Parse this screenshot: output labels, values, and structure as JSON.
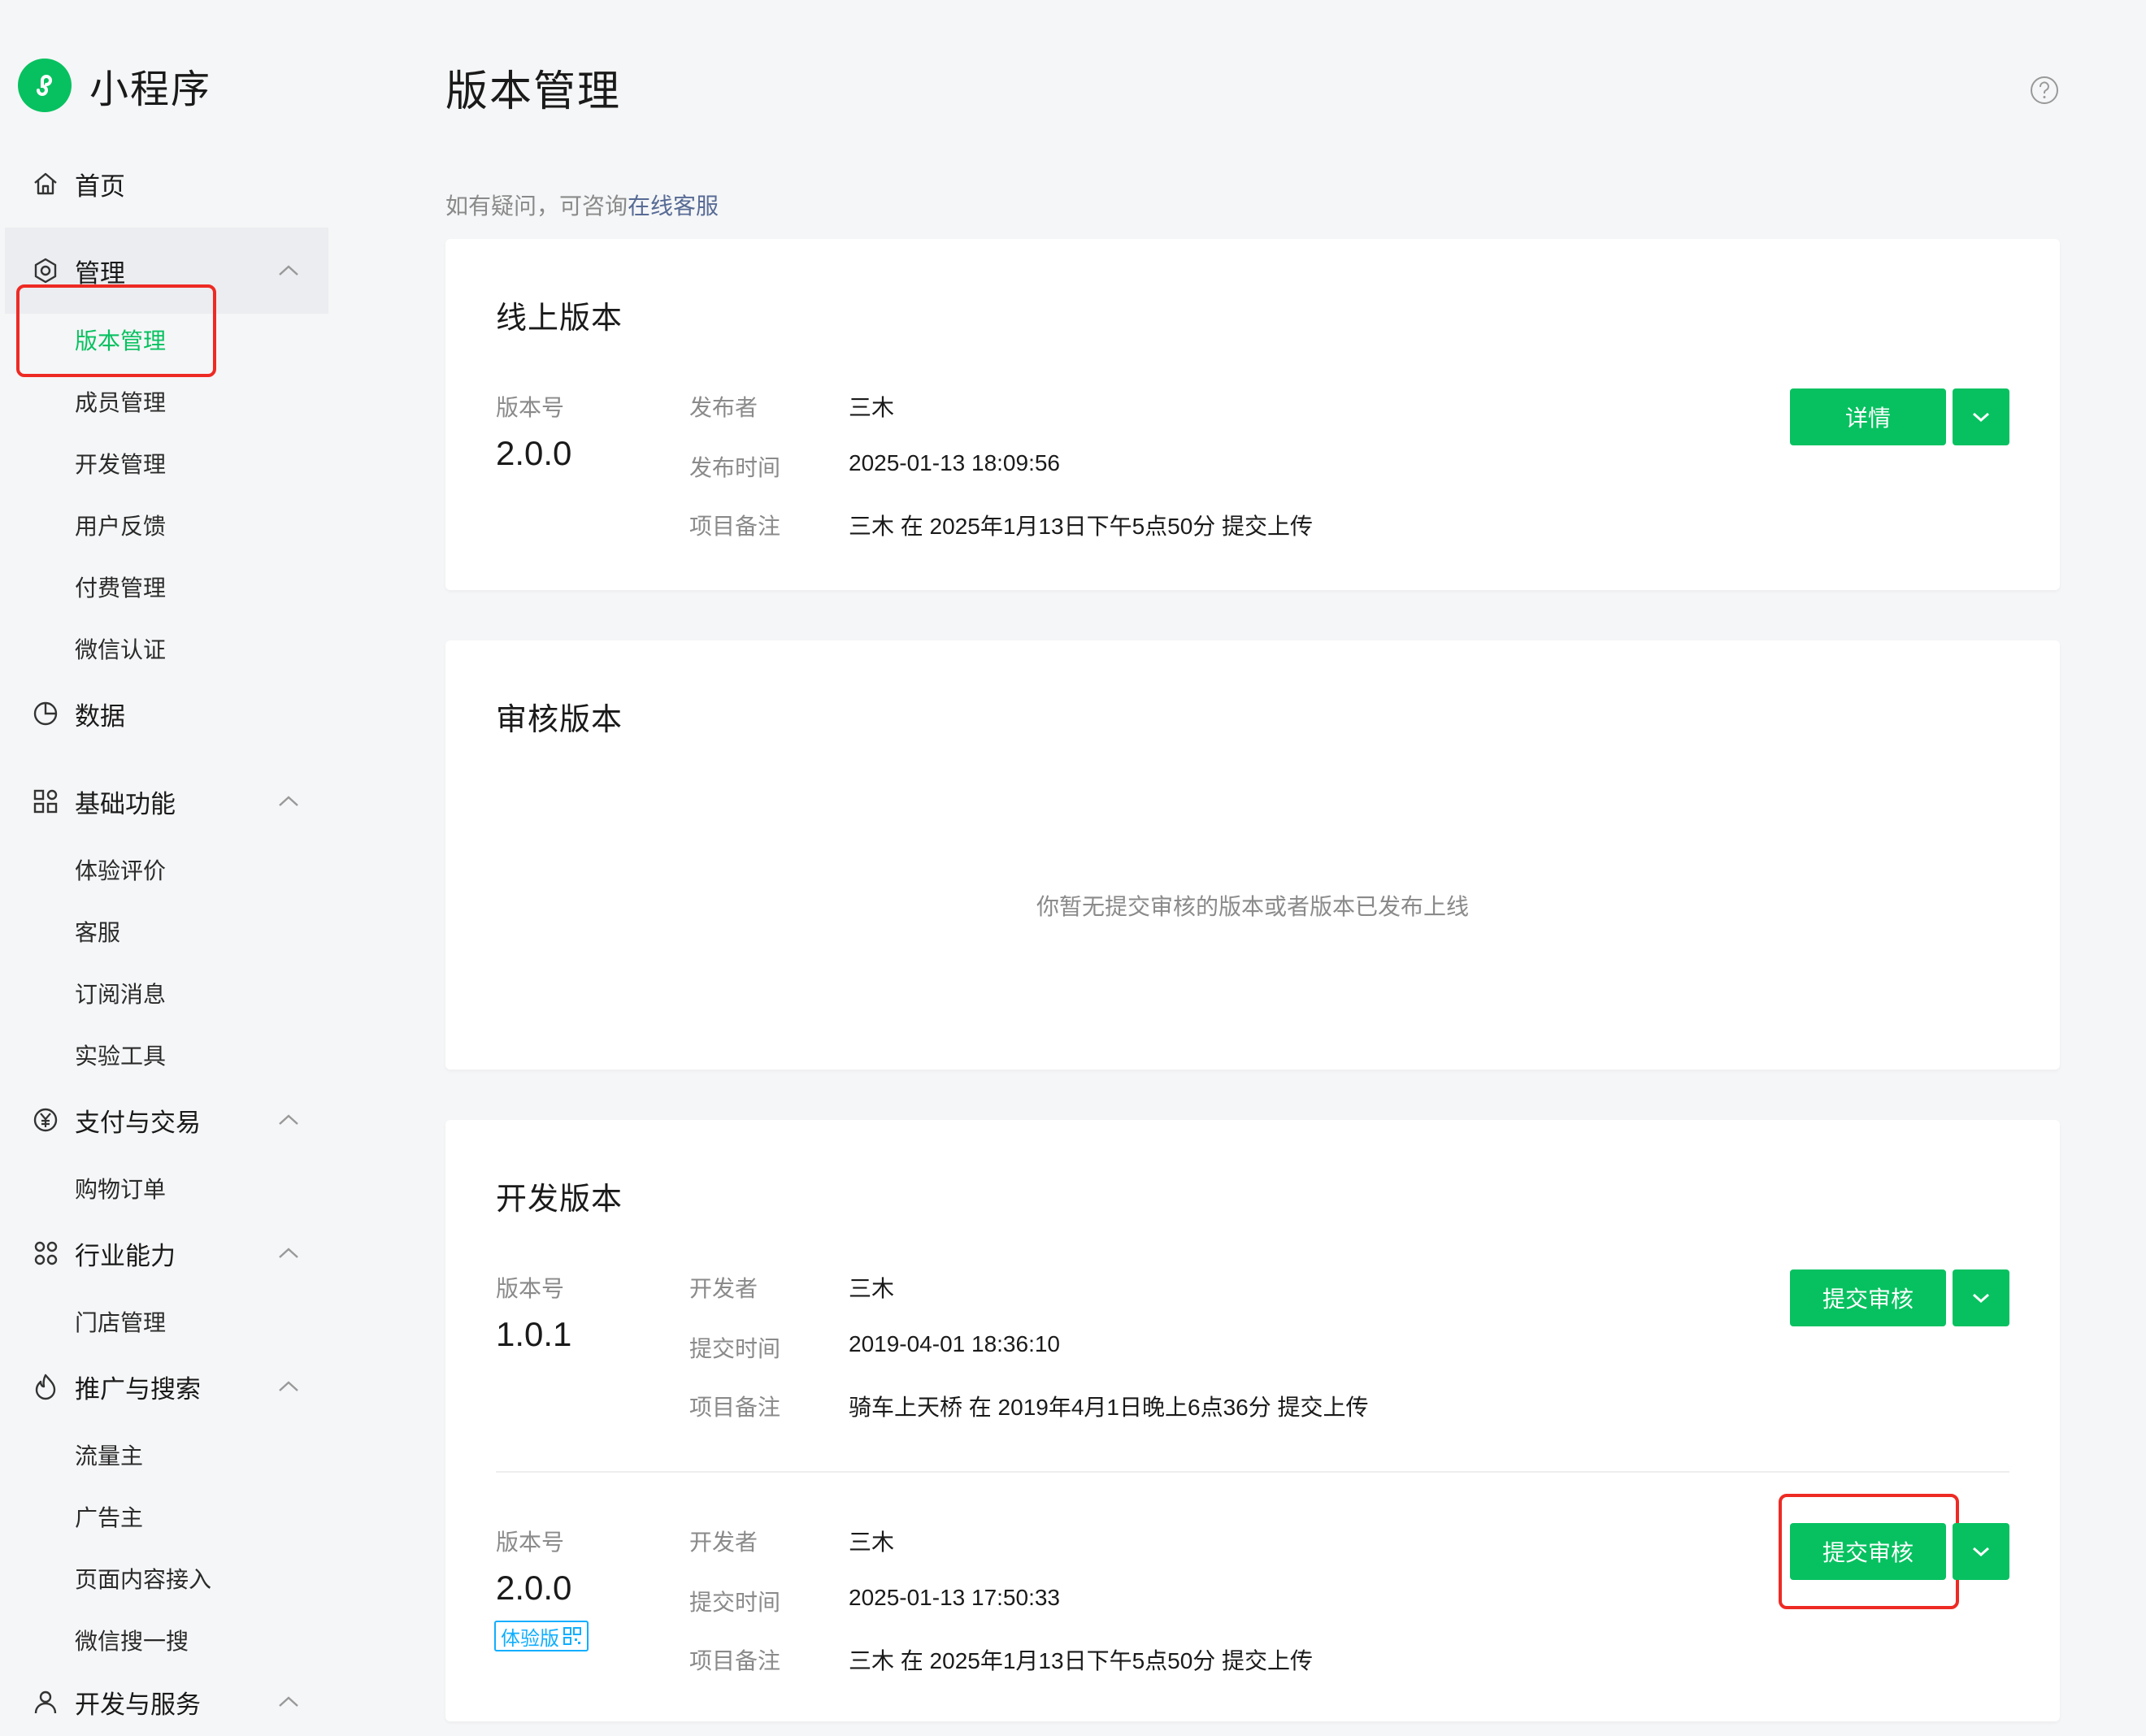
{
  "sidebar": {
    "logo_text": "小程序",
    "home": "首页",
    "groups": {
      "manage": {
        "label": "管理",
        "items": [
          "版本管理",
          "成员管理",
          "开发管理",
          "用户反馈",
          "付费管理",
          "微信认证"
        ]
      },
      "data": {
        "label": "数据"
      },
      "basic": {
        "label": "基础功能",
        "items": [
          "体验评价",
          "客服",
          "订阅消息",
          "实验工具"
        ]
      },
      "pay": {
        "label": "支付与交易",
        "items": [
          "购物订单"
        ]
      },
      "industry": {
        "label": "行业能力",
        "items": [
          "门店管理"
        ]
      },
      "promo": {
        "label": "推广与搜索",
        "items": [
          "流量主",
          "广告主",
          "页面内容接入",
          "微信搜一搜"
        ]
      },
      "devservice": {
        "label": "开发与服务"
      }
    }
  },
  "header": {
    "title": "版本管理",
    "hint_prefix": "如有疑问，可咨询",
    "hint_link": "在线客服"
  },
  "online": {
    "title": "线上版本",
    "version_label": "版本号",
    "version": "2.0.0",
    "publisher_label": "发布者",
    "publisher": "三木",
    "time_label": "发布时间",
    "time": "2025-01-13 18:09:56",
    "note_label": "项目备注",
    "note": "三木 在 2025年1月13日下午5点50分 提交上传",
    "detail_button": "详情"
  },
  "review": {
    "title": "审核版本",
    "empty": "你暂无提交审核的版本或者版本已发布上线"
  },
  "dev": {
    "title": "开发版本",
    "versions": [
      {
        "version_label": "版本号",
        "version": "1.0.1",
        "dev_label": "开发者",
        "developer": "三木",
        "time_label": "提交时间",
        "time": "2019-04-01 18:36:10",
        "note_label": "项目备注",
        "note": "骑车上天桥 在 2019年4月1日晚上6点36分 提交上传",
        "submit_button": "提交审核"
      },
      {
        "version_label": "版本号",
        "version": "2.0.0",
        "tag": "体验版",
        "dev_label": "开发者",
        "developer": "三木",
        "time_label": "提交时间",
        "time": "2025-01-13 17:50:33",
        "note_label": "项目备注",
        "note": "三木 在 2025年1月13日下午5点50分 提交上传",
        "submit_button": "提交审核"
      }
    ]
  },
  "colors": {
    "brand_green": "#07c160",
    "link_blue": "#576b95",
    "tag_blue": "#10aeff",
    "highlight_red": "#ee2a24"
  }
}
